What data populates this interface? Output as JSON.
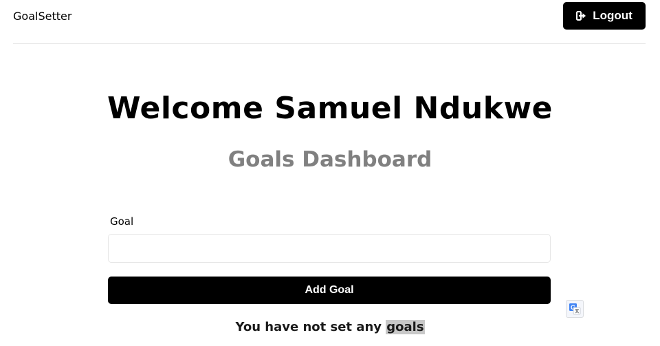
{
  "header": {
    "brand": "GoalSetter",
    "logout_label": "Logout",
    "logout_icon": "sign-out-icon"
  },
  "main": {
    "welcome": "Welcome Samuel Ndukwe",
    "subtitle": "Goals Dashboard"
  },
  "form": {
    "goal_label": "Goal",
    "goal_value": "",
    "add_label": "Add Goal"
  },
  "goals": {
    "empty_message_prefix": "You have not set any ",
    "empty_message_highlight": "goals"
  },
  "extension": {
    "translate_icon": "google-translate-icon"
  },
  "colors": {
    "primary": "#000000",
    "subtitle": "#808080",
    "highlight": "#c8c8c8"
  }
}
